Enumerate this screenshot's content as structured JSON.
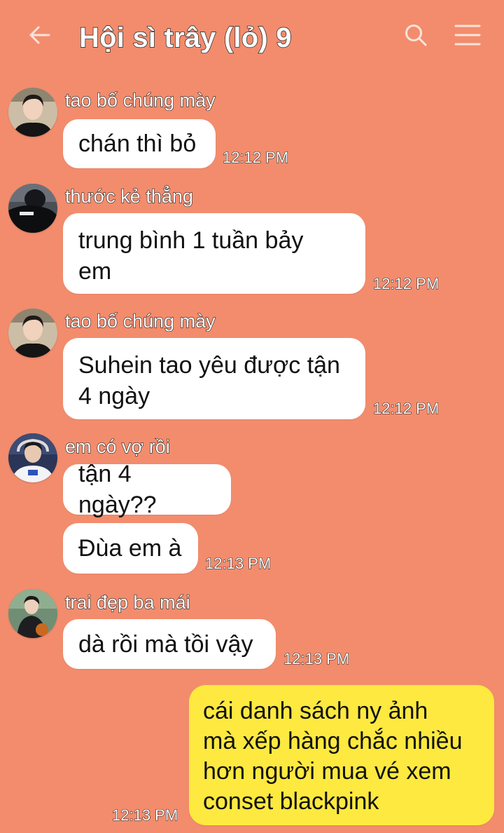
{
  "header": {
    "title": "Hội sì trây (lỏ) 9",
    "back_icon": "arrow-left-icon",
    "search_icon": "search-icon",
    "menu_icon": "hamburger-menu-icon"
  },
  "colors": {
    "background": "#f28c6d",
    "incoming_bubble": "#ffffff",
    "outgoing_bubble": "#fde93f"
  },
  "messages": [
    {
      "sender": "tao bố chúng mày",
      "text": "chán thì bỏ",
      "time": "12:12 PM"
    },
    {
      "sender": "thước kẻ thẳng",
      "text": "trung bình 1 tuần bảy\nem",
      "time": "12:12 PM"
    },
    {
      "sender": "tao bố chúng mày",
      "text": "Suhein tao yêu được tận\n4 ngày",
      "time": "12:12 PM"
    },
    {
      "sender": "em có vợ rồi",
      "text": "tận 4 ngày??",
      "time": ""
    },
    {
      "sender": "",
      "text": "Đùa em à",
      "time": "12:13 PM"
    },
    {
      "sender": "trai đẹp ba mái",
      "text": "dà rồi mà tồi vậy",
      "time": "12:13 PM"
    },
    {
      "sender": "",
      "text": "cái danh sách ny ảnh\nmà xếp hàng chắc nhiều\nhơn người mua vé xem\nconset blackpink",
      "time": "12:13 PM"
    }
  ]
}
